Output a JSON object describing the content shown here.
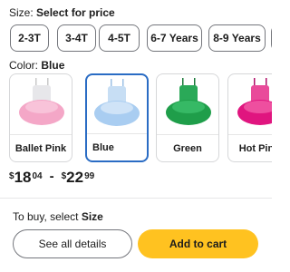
{
  "size": {
    "label_prefix": "Size:",
    "label_value": "Select for price",
    "options": [
      "2-3T",
      "3-4T",
      "4-5T",
      "6-7 Years",
      "8-9 Years"
    ]
  },
  "color": {
    "label_prefix": "Color:",
    "label_value": "Blue",
    "options": [
      {
        "name": "Ballet Pink",
        "hex": "#f4a7c7",
        "selected": false
      },
      {
        "name": "Blue",
        "hex": "#a9cdf1",
        "selected": true
      },
      {
        "name": "Green",
        "hex": "#1f9e4a",
        "selected": false
      },
      {
        "name": "Hot Pink",
        "hex": "#e0157f",
        "selected": false
      }
    ]
  },
  "price": {
    "currency": "$",
    "low_main": "18",
    "low_cents": "04",
    "separator": "-",
    "high_main": "22",
    "high_cents": "99"
  },
  "footer": {
    "note_prefix": "To buy, select",
    "note_value": "Size",
    "see_details_label": "See all details",
    "add_to_cart_label": "Add to cart"
  },
  "colors": {
    "selected_border": "#2a6cc4",
    "cart_button": "#ffc220"
  }
}
